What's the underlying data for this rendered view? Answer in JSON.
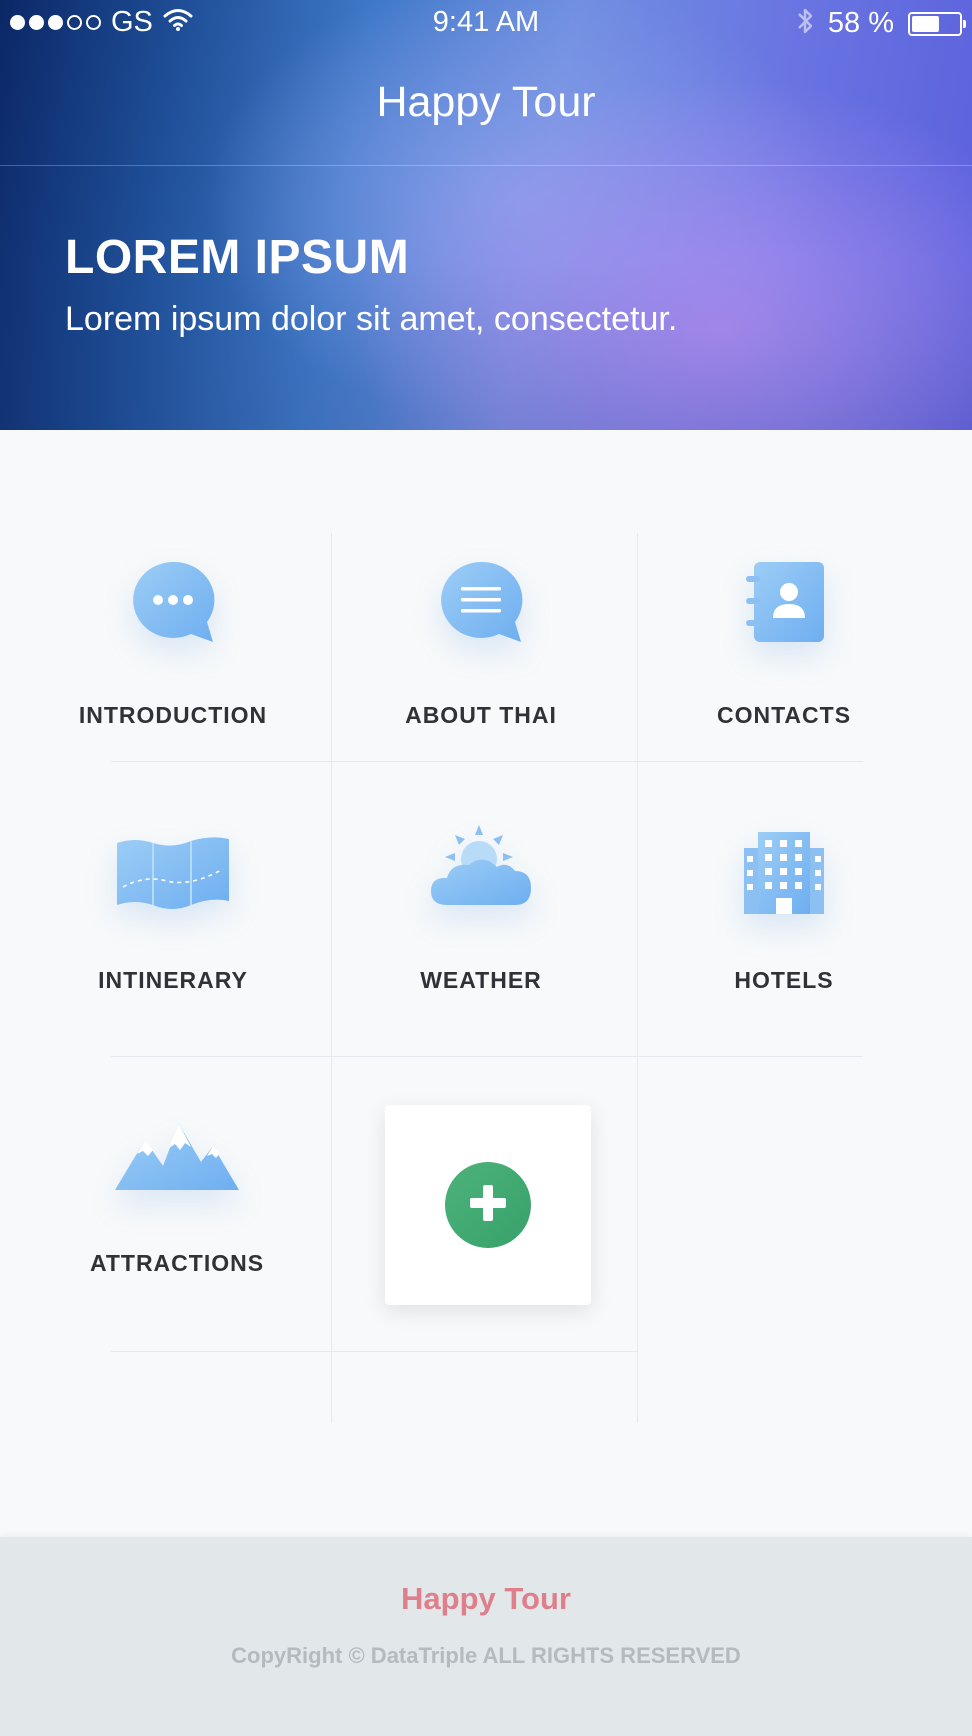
{
  "status_bar": {
    "carrier": "GS",
    "time": "9:41 AM",
    "battery_percent_text": "58 %",
    "battery_level": 0.58
  },
  "nav": {
    "title": "Happy Tour"
  },
  "hero": {
    "heading": "LOREM IPSUM",
    "subtitle": "Lorem ipsum dolor sit amet, consectetur."
  },
  "menu": {
    "items": [
      {
        "label": "INTRODUCTION",
        "icon": "chat-bubble-dots-icon"
      },
      {
        "label": "ABOUT THAI",
        "icon": "chat-bubble-lines-icon"
      },
      {
        "label": "CONTACTS",
        "icon": "address-book-icon"
      },
      {
        "label": "INTINERARY",
        "icon": "map-icon"
      },
      {
        "label": "WEATHER",
        "icon": "sun-cloud-icon"
      },
      {
        "label": "HOTELS",
        "icon": "building-icon"
      },
      {
        "label": "ATTRACTIONS",
        "icon": "mountains-icon"
      }
    ],
    "add_icon": "plus-icon"
  },
  "colors": {
    "icon_blue": "#7fb8ef",
    "add_green": "#43a96f",
    "footer_title": "#e07f8c"
  },
  "footer": {
    "title": "Happy Tour",
    "copyright": "CopyRight © DataTriple ALL RIGHTS RESERVED"
  }
}
